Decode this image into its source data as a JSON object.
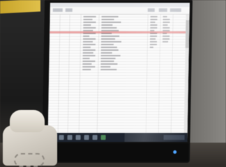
{
  "image": {
    "kind": "photo-of-monitor",
    "colors": {
      "sheet_highlight_row": "#e58a8a",
      "taskbar": "#1d2430",
      "sticky_note": "#d8b83a",
      "phone_body": "#e2ddd3"
    },
    "icons": [
      "desk-phone-icon",
      "monitor-icon",
      "spreadsheet-icon",
      "taskbar-app-icon"
    ]
  }
}
